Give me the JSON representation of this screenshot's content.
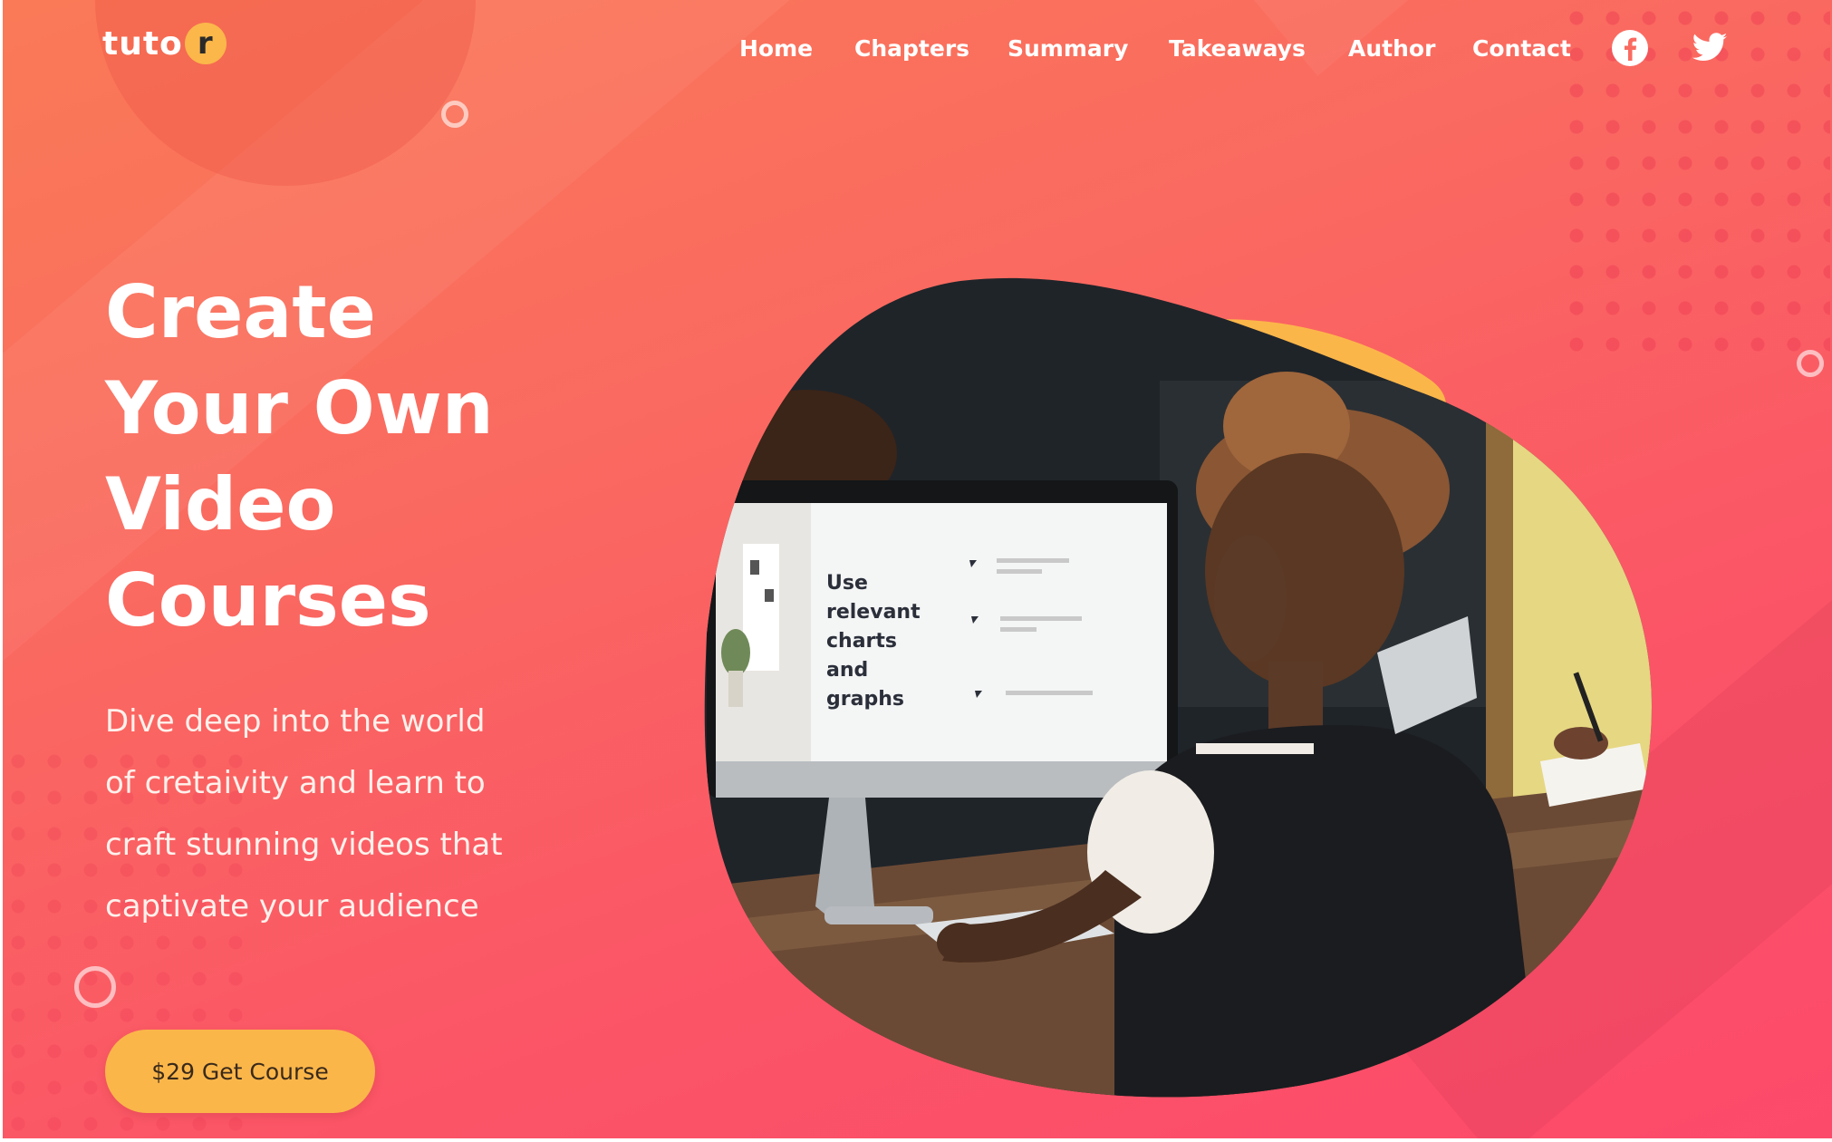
{
  "brand": {
    "logo_text": "tuto",
    "logo_badge_letter": "r"
  },
  "nav": {
    "links": [
      "Home",
      "Chapters",
      "Summary",
      "Takeaways",
      "Author",
      "Contact"
    ],
    "social_icons": [
      "facebook-icon",
      "twitter-icon"
    ]
  },
  "hero": {
    "title_lines": [
      "Create",
      "Your Own",
      "Video",
      "Courses"
    ],
    "description_lines": [
      "Dive deep into the world",
      "of cretaivity and learn to",
      "craft stunning videos that",
      "captivate your audience"
    ],
    "cta_label": "$29 Get Course"
  },
  "hero_image": {
    "monitor_slide_lines": [
      "Use",
      "relevant",
      "charts",
      "and",
      "graphs"
    ]
  },
  "colors": {
    "background_start": "#fa7a57",
    "background_end": "#fc4a6b",
    "accent": "#fbb64a",
    "text": "#ffffff"
  }
}
